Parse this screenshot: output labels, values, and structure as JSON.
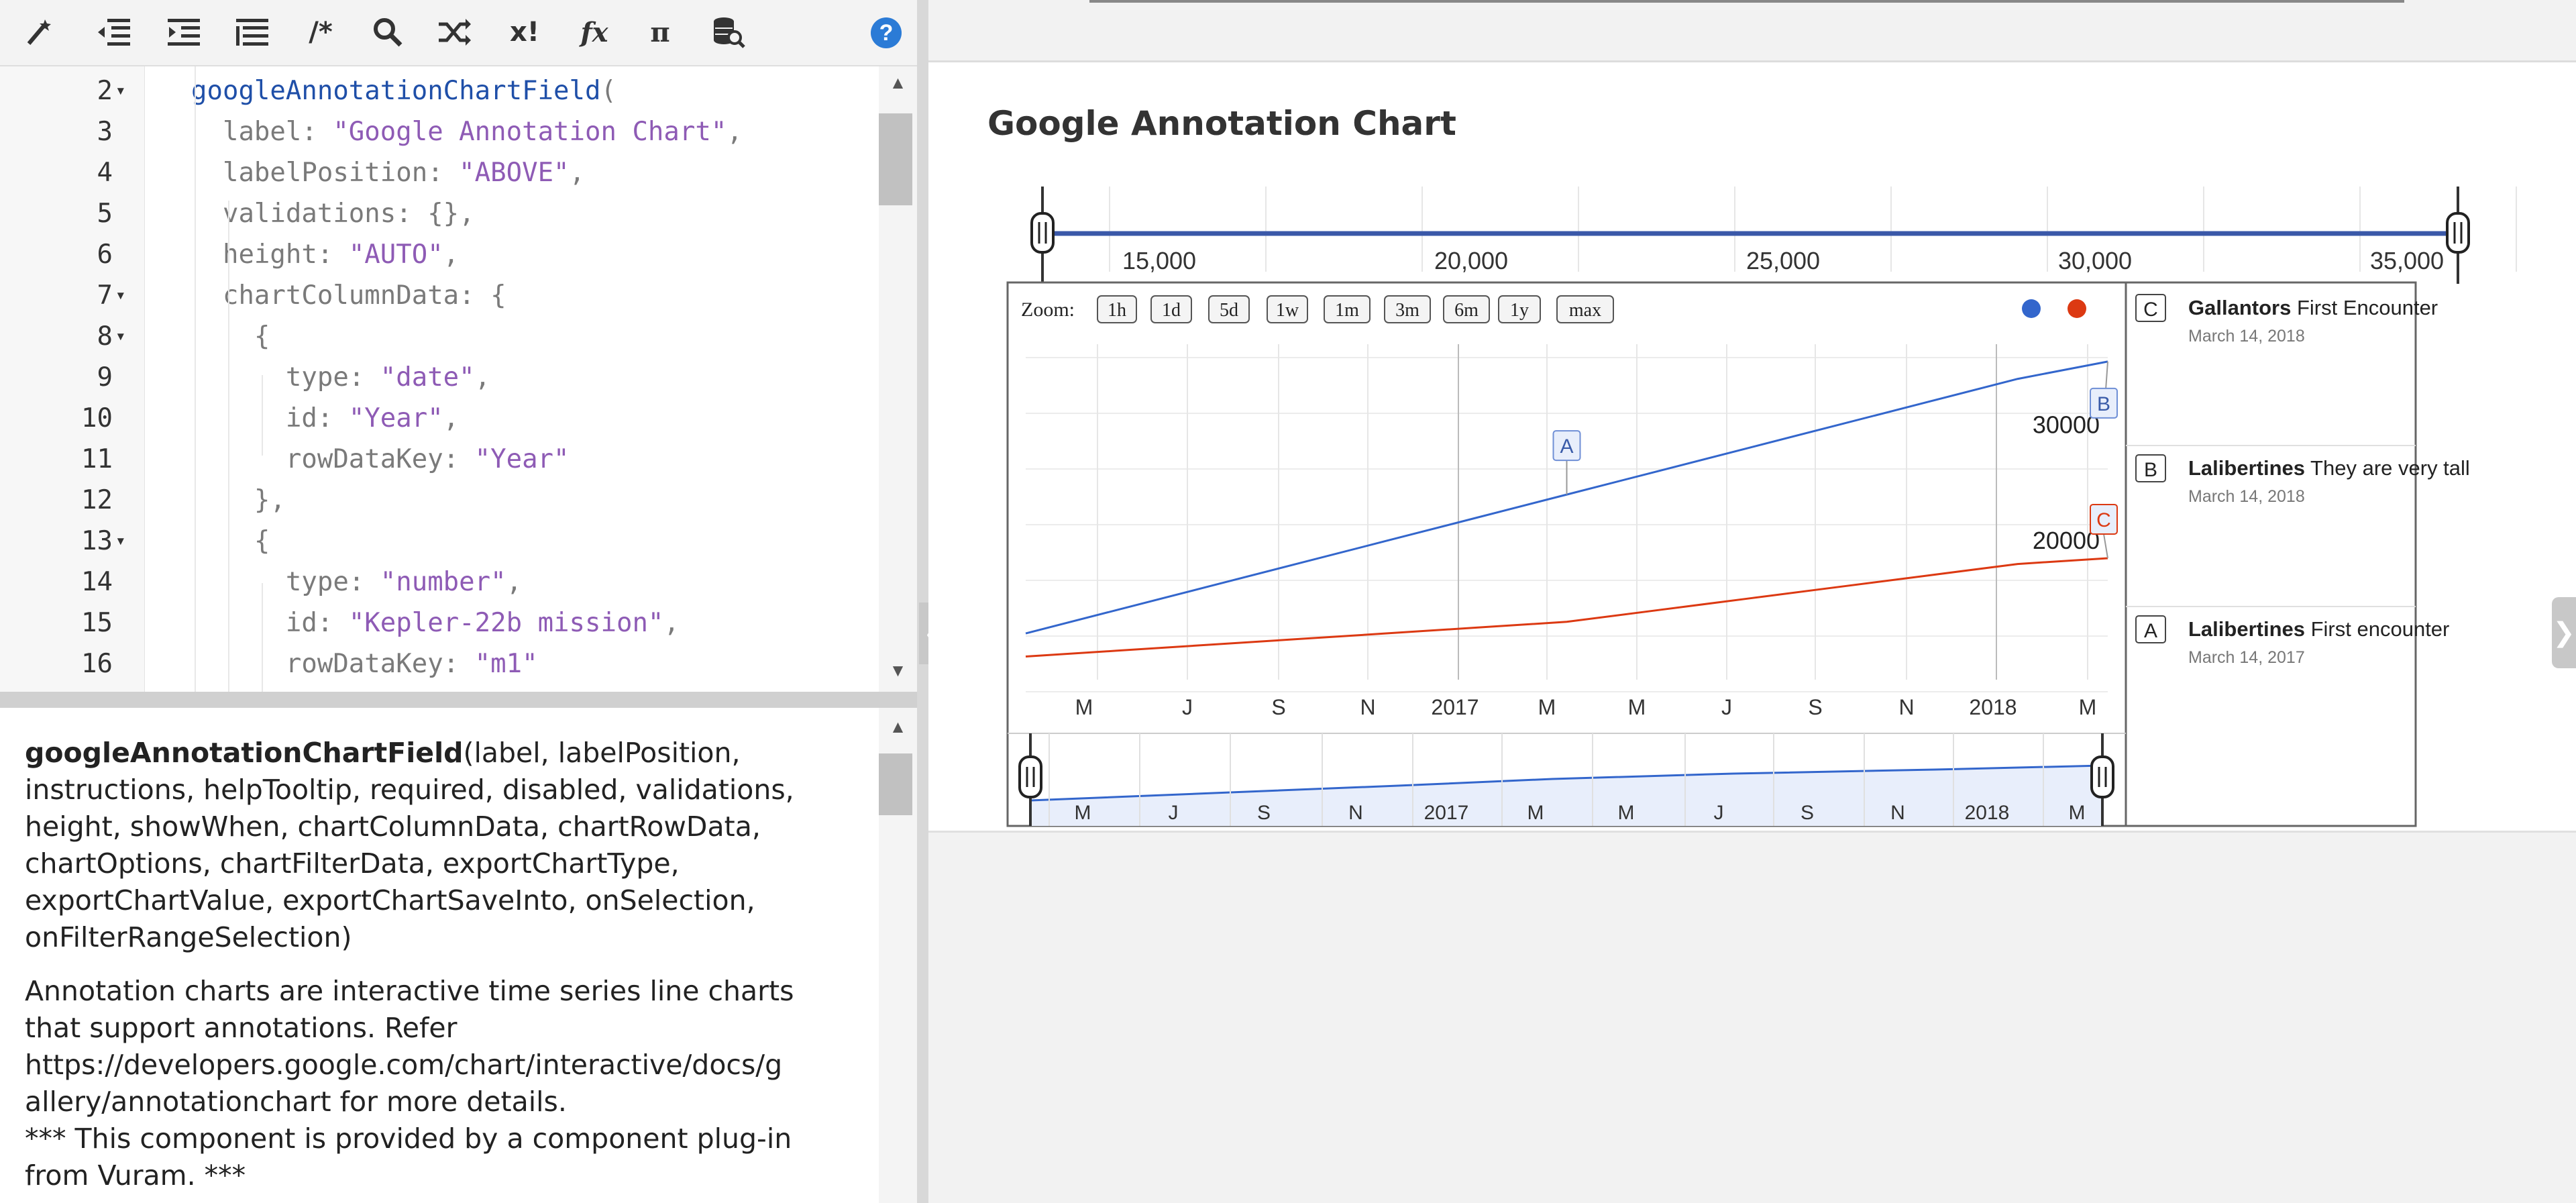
{
  "toolbar": {
    "buttons": [
      {
        "icon": "magic-wand-icon"
      },
      {
        "icon": "outdent-icon"
      },
      {
        "icon": "indent-icon"
      },
      {
        "icon": "format-list-icon"
      },
      {
        "icon": "comment-icon",
        "glyph": "/*"
      },
      {
        "icon": "search-icon"
      },
      {
        "icon": "shuffle-icon"
      },
      {
        "icon": "expression-icon",
        "glyph": "x!"
      },
      {
        "icon": "function-icon",
        "glyph": "fx"
      },
      {
        "icon": "pi-icon",
        "glyph": "π"
      },
      {
        "icon": "database-search-icon"
      }
    ],
    "help_glyph": "?"
  },
  "editor": {
    "lines": [
      {
        "num": "2",
        "fold": "▾",
        "code": "googleAnnotationChartField("
      },
      {
        "num": "3",
        "fold": "",
        "code": "  label: \"Google Annotation Chart\","
      },
      {
        "num": "4",
        "fold": "",
        "code": "  labelPosition: \"ABOVE\","
      },
      {
        "num": "5",
        "fold": "",
        "code": "  validations: {},"
      },
      {
        "num": "6",
        "fold": "",
        "code": "  height: \"AUTO\","
      },
      {
        "num": "7",
        "fold": "▾",
        "code": "  chartColumnData: {"
      },
      {
        "num": "8",
        "fold": "▾",
        "code": "    {"
      },
      {
        "num": "9",
        "fold": "",
        "code": "      type: \"date\","
      },
      {
        "num": "10",
        "fold": "",
        "code": "      id: \"Year\","
      },
      {
        "num": "11",
        "fold": "",
        "code": "      rowDataKey: \"Year\""
      },
      {
        "num": "12",
        "fold": "",
        "code": "    },"
      },
      {
        "num": "13",
        "fold": "▾",
        "code": "    {"
      },
      {
        "num": "14",
        "fold": "",
        "code": "      type: \"number\","
      },
      {
        "num": "15",
        "fold": "",
        "code": "      id: \"Kepler-22b mission\","
      },
      {
        "num": "16",
        "fold": "",
        "code": "      rowDataKey: \"m1\""
      }
    ]
  },
  "doc": {
    "fn_name": "googleAnnotationChartField",
    "params": "(label, labelPosition, instructions, helpTooltip, required, disabled, validations, height, showWhen, chartColumnData, chartRowData, chartOptions, chartFilterData, exportChartType, exportChartValue, exportChartSaveInto, onSelection, onFilterRangeSelection)",
    "description_lines": [
      "Annotation charts are interactive time series line charts",
      "that support annotations. Refer",
      "https://developers.google.com/chart/interactive/docs/g",
      "allery/annotationchart for more details.",
      "*** This component is provided by a component plug-in",
      "from Vuram. ***"
    ]
  },
  "chart": {
    "title": "Google Annotation Chart",
    "zoom_label": "Zoom:",
    "zoom_buttons": [
      "1h",
      "1d",
      "5d",
      "1w",
      "1m",
      "3m",
      "6m",
      "1y",
      "max"
    ],
    "series_colors": {
      "blue": "#3366cc",
      "red": "#dc3912"
    },
    "range_axis_ticks": [
      "15,000",
      "20,000",
      "25,000",
      "30,000",
      "35,000"
    ],
    "main_y_ticks": [
      "30000",
      "20000"
    ],
    "main_x_ticks": [
      "M",
      "J",
      "S",
      "N",
      "2017",
      "M",
      "M",
      "J",
      "S",
      "N",
      "2018",
      "M"
    ],
    "nav_x_ticks": [
      "M",
      "J",
      "S",
      "N",
      "2017",
      "M",
      "M",
      "J",
      "S",
      "N",
      "2018",
      "M"
    ],
    "annotations": [
      {
        "letter": "C",
        "title": "Gallantors",
        "text": "First Encounter",
        "date": "March 14, 2018"
      },
      {
        "letter": "B",
        "title": "Lalibertines",
        "text": "They are very tall",
        "date": "March 14, 2018"
      },
      {
        "letter": "A",
        "title": "Lalibertines",
        "text": "First encounter",
        "date": "March 14, 2017"
      }
    ],
    "flags": [
      "A",
      "B",
      "C"
    ]
  },
  "chart_data": {
    "type": "line",
    "title": "Google Annotation Chart",
    "x": [
      "2016-03",
      "2016-05",
      "2016-07",
      "2016-09",
      "2016-11",
      "2017-01",
      "2017-03",
      "2017-05",
      "2017-07",
      "2017-09",
      "2017-11",
      "2018-01",
      "2018-03"
    ],
    "series": [
      {
        "values": [
          12000,
          14000,
          16000,
          18000,
          20000,
          22000,
          24000,
          26000,
          28000,
          30000,
          32000,
          34000,
          35500
        ]
      },
      {
        "values": [
          10000,
          10500,
          11000,
          11500,
          12000,
          12500,
          13000,
          14000,
          15000,
          16000,
          17000,
          18000,
          18500
        ]
      }
    ],
    "y_ticks": [
      20000,
      30000
    ],
    "ylim": [
      8000,
      37000
    ],
    "annotations": [
      {
        "letter": "A",
        "x": "2017-03",
        "series": 0
      },
      {
        "letter": "B",
        "x": "2018-03",
        "series": 0
      },
      {
        "letter": "C",
        "x": "2018-03",
        "series": 1
      }
    ],
    "legend": "top-right",
    "grid": true
  }
}
